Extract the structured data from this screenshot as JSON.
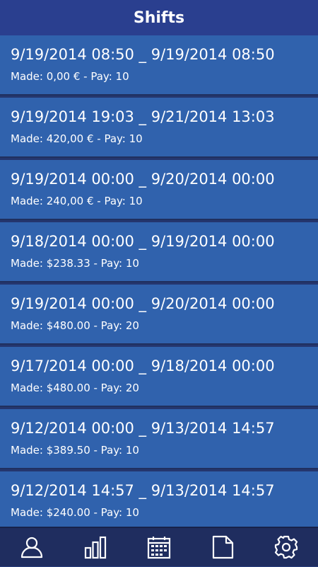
{
  "header": {
    "title": "Shifts"
  },
  "shifts": [
    {
      "range": "9/19/2014 08:50 _ 9/19/2014 08:50",
      "summary": "Made: 0,00 € - Pay: 10"
    },
    {
      "range": "9/19/2014 19:03 _ 9/21/2014 13:03",
      "summary": "Made: 420,00 € - Pay: 10"
    },
    {
      "range": "9/19/2014 00:00 _ 9/20/2014 00:00",
      "summary": "Made: 240,00 € - Pay: 10"
    },
    {
      "range": "9/18/2014 00:00 _ 9/19/2014 00:00",
      "summary": "Made: $238.33 - Pay: 10"
    },
    {
      "range": "9/19/2014 00:00 _ 9/20/2014 00:00",
      "summary": "Made: $480.00 - Pay: 20"
    },
    {
      "range": "9/17/2014 00:00 _ 9/18/2014 00:00",
      "summary": "Made: $480.00 - Pay: 20"
    },
    {
      "range": "9/12/2014 00:00 _ 9/13/2014 14:57",
      "summary": "Made: $389.50 - Pay: 10"
    },
    {
      "range": "9/12/2014 14:57 _ 9/13/2014 14:57",
      "summary": "Made: $240.00 - Pay: 10"
    }
  ],
  "tabs": [
    {
      "icon": "profile-icon"
    },
    {
      "icon": "bar-chart-icon"
    },
    {
      "icon": "calendar-icon"
    },
    {
      "icon": "document-icon"
    },
    {
      "icon": "gear-icon"
    }
  ],
  "colors": {
    "header_bg": "#2a3f8f",
    "row_bg": "#3062ad",
    "tabbar_bg": "#1f2d5f",
    "text": "#ffffff"
  }
}
